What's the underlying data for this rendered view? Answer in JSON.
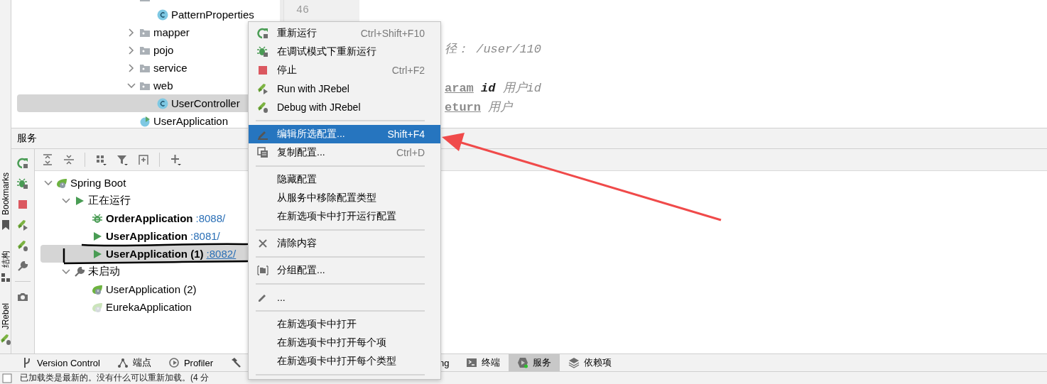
{
  "side_strip": [
    {
      "label": "Bookmarks",
      "kind": "bookmark"
    },
    {
      "label": "结构",
      "kind": "structure"
    },
    {
      "label": "JRebel",
      "kind": "jrebel"
    }
  ],
  "project_tree": [
    {
      "kind": "folder",
      "children": [
        {
          "label": "PatternProperties",
          "kind": "class",
          "selected": false
        }
      ]
    },
    {
      "label": "mapper",
      "kind": "folder",
      "expanded": false,
      "selected": false
    },
    {
      "label": "pojo",
      "kind": "folder",
      "expanded": false,
      "selected": false
    },
    {
      "label": "service",
      "kind": "folder",
      "expanded": false,
      "selected": false
    },
    {
      "label": "web",
      "kind": "folder",
      "expanded": true,
      "selected": false,
      "children": [
        {
          "label": "UserController",
          "kind": "class",
          "selected": true
        }
      ]
    },
    {
      "label": "UserApplication",
      "kind": "spring-class",
      "selected": false
    }
  ],
  "editor": {
    "line_number": "46",
    "lines": [
      [
        {
          "text": "径：  /user/110",
          "kind": "comment"
        }
      ],
      [
        {
          "text": "aram",
          "kind": "tag"
        },
        {
          "text": " id",
          "kind": "param"
        },
        {
          "text": " 用户id",
          "kind": "comment"
        }
      ],
      [
        {
          "text": "eturn",
          "kind": "tag"
        },
        {
          "text": " 用户",
          "kind": "comment"
        }
      ]
    ]
  },
  "services": {
    "title": "服务",
    "tree": [
      {
        "label": "Spring Boot",
        "kind": "spring",
        "expanded": true,
        "selected": false,
        "children": [
          {
            "label": "正在运行",
            "kind": "run",
            "expanded": true,
            "selected": false,
            "children": [
              {
                "label": "OrderApplication",
                "port": ":8088/",
                "kind": "debug",
                "bold": true,
                "selected": false
              },
              {
                "label": "UserApplication",
                "port": ":8081/",
                "kind": "run",
                "bold": true,
                "selected": false
              },
              {
                "label": "UserApplication (1)",
                "port": ":8082/",
                "kind": "run",
                "bold": true,
                "selected": true
              }
            ]
          },
          {
            "label": "未启动",
            "kind": "wrench",
            "expanded": true,
            "selected": false,
            "children": [
              {
                "label": "UserApplication (2)",
                "kind": "spring",
                "bold": false,
                "selected": false
              },
              {
                "label": "EurekaApplication",
                "kind": "spring-dim",
                "bold": false,
                "selected": false
              }
            ]
          }
        ]
      }
    ]
  },
  "context_menu": {
    "items": [
      {
        "kind": "rerun",
        "label": "重新运行",
        "shortcut": "Ctrl+Shift+F10",
        "selected": false
      },
      {
        "kind": "debug-rerun",
        "label": "在调试模式下重新运行",
        "selected": false
      },
      {
        "kind": "stop",
        "label": "停止",
        "shortcut": "Ctrl+F2",
        "selected": false
      },
      {
        "kind": "jrebel-run",
        "label": "Run with JRebel",
        "selected": false
      },
      {
        "kind": "jrebel-debug",
        "label": "Debug with JRebel",
        "selected": false
      },
      {
        "kind": "separator"
      },
      {
        "kind": "edit",
        "label": "编辑所选配置...",
        "shortcut": "Shift+F4",
        "selected": true
      },
      {
        "kind": "copy",
        "label": "复制配置...",
        "shortcut": "Ctrl+D",
        "selected": false
      },
      {
        "kind": "separator"
      },
      {
        "kind": "plain",
        "label": "隐藏配置",
        "selected": false
      },
      {
        "kind": "plain",
        "label": "从服务中移除配置类型",
        "selected": false
      },
      {
        "kind": "plain",
        "label": "在新选项卡中打开运行配置",
        "selected": false
      },
      {
        "kind": "separator"
      },
      {
        "kind": "clear",
        "label": "清除内容",
        "selected": false
      },
      {
        "kind": "separator"
      },
      {
        "kind": "group",
        "label": "分组配置...",
        "selected": false
      },
      {
        "kind": "separator"
      },
      {
        "kind": "pencil",
        "label": "...",
        "selected": false
      },
      {
        "kind": "separator"
      },
      {
        "kind": "plain",
        "label": "在新选项卡中打开",
        "selected": false
      },
      {
        "kind": "plain",
        "label": "在新选项卡中打开每个项",
        "selected": false
      },
      {
        "kind": "plain",
        "label": "在新选项卡中打开每个类型",
        "selected": false
      },
      {
        "kind": "separator"
      }
    ]
  },
  "bottom_tabs_left": [
    {
      "label": "Version Control",
      "kind": "branch",
      "selected": false
    },
    {
      "label": "端点",
      "kind": "endpoints",
      "selected": false
    },
    {
      "label": "Profiler",
      "kind": "profiler",
      "selected": false
    },
    {
      "kind": "hammer",
      "selected": false
    }
  ],
  "bottom_tabs_right": [
    {
      "label": "ng",
      "kind": "plain",
      "selected": false
    },
    {
      "label": "终端",
      "kind": "terminal",
      "selected": false
    },
    {
      "label": "服务",
      "kind": "services",
      "selected": true
    },
    {
      "label": "依赖项",
      "kind": "layers",
      "selected": false
    }
  ],
  "status_bar": {
    "text": "已加载类是最新的。没有什么可以重新加载。(4 分"
  }
}
